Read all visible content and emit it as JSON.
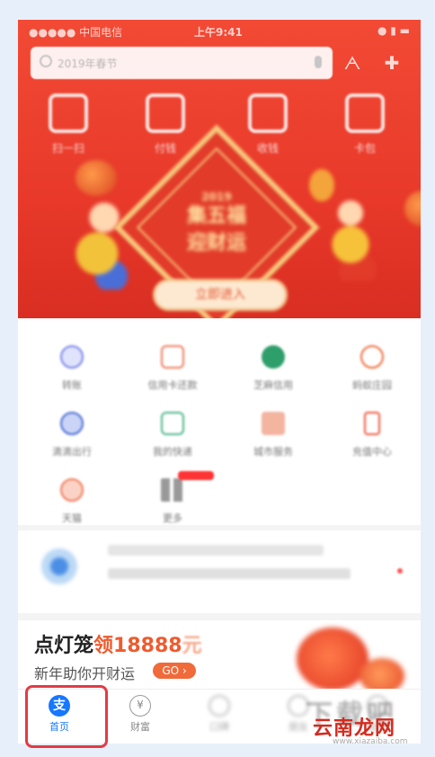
{
  "statusbar": {
    "left": "●●●●● 中国电信 ",
    "time": "上午9:41",
    "right": "● ▮ ▬"
  },
  "search": {
    "placeholder": "2019年春节"
  },
  "quick_actions": [
    {
      "label": "扫一扫"
    },
    {
      "label": "付钱"
    },
    {
      "label": "收钱"
    },
    {
      "label": "卡包"
    }
  ],
  "banner": {
    "badge": "2019",
    "title": "集五福\n迎财运",
    "cta": "立即进入"
  },
  "apps": [
    {
      "label": "转账",
      "color": "#7b86e8"
    },
    {
      "label": "信用卡还款",
      "color": "#f07a5a"
    },
    {
      "label": "芝麻信用",
      "color": "#2e9e6b"
    },
    {
      "label": "蚂蚁庄园",
      "color": "#f06a3a"
    },
    {
      "label": "滴滴出行",
      "color": "#4b6cd6"
    },
    {
      "label": "我的快递",
      "color": "#4bb38a"
    },
    {
      "label": "城市服务",
      "color": "#e7643c"
    },
    {
      "label": "充值中心",
      "color": "#f0553c"
    },
    {
      "label": "天猫",
      "color": "#f07a5a"
    },
    {
      "label": "更多",
      "color": "#999999"
    }
  ],
  "promo": {
    "title_a": "点灯笼",
    "title_b": "领18888",
    "title_c": "元",
    "subtitle": "新年助你开财运",
    "go": "GO"
  },
  "tabbar": [
    {
      "label": "首页",
      "icon": "支"
    },
    {
      "label": "财富",
      "icon": "¥"
    },
    {
      "label": "口碑",
      "icon": ""
    },
    {
      "label": "朋友",
      "icon": ""
    },
    {
      "label": "我的",
      "icon": ""
    }
  ],
  "watermark": {
    "big": "下载吧",
    "brand": "云南龙网",
    "url": "www.xiazaiba.com"
  },
  "colors": {
    "accent": "#1677ff",
    "hero_red": "#e8392a",
    "promo_orange": "#ef5b2e",
    "highlight_red": "#e33b45"
  }
}
